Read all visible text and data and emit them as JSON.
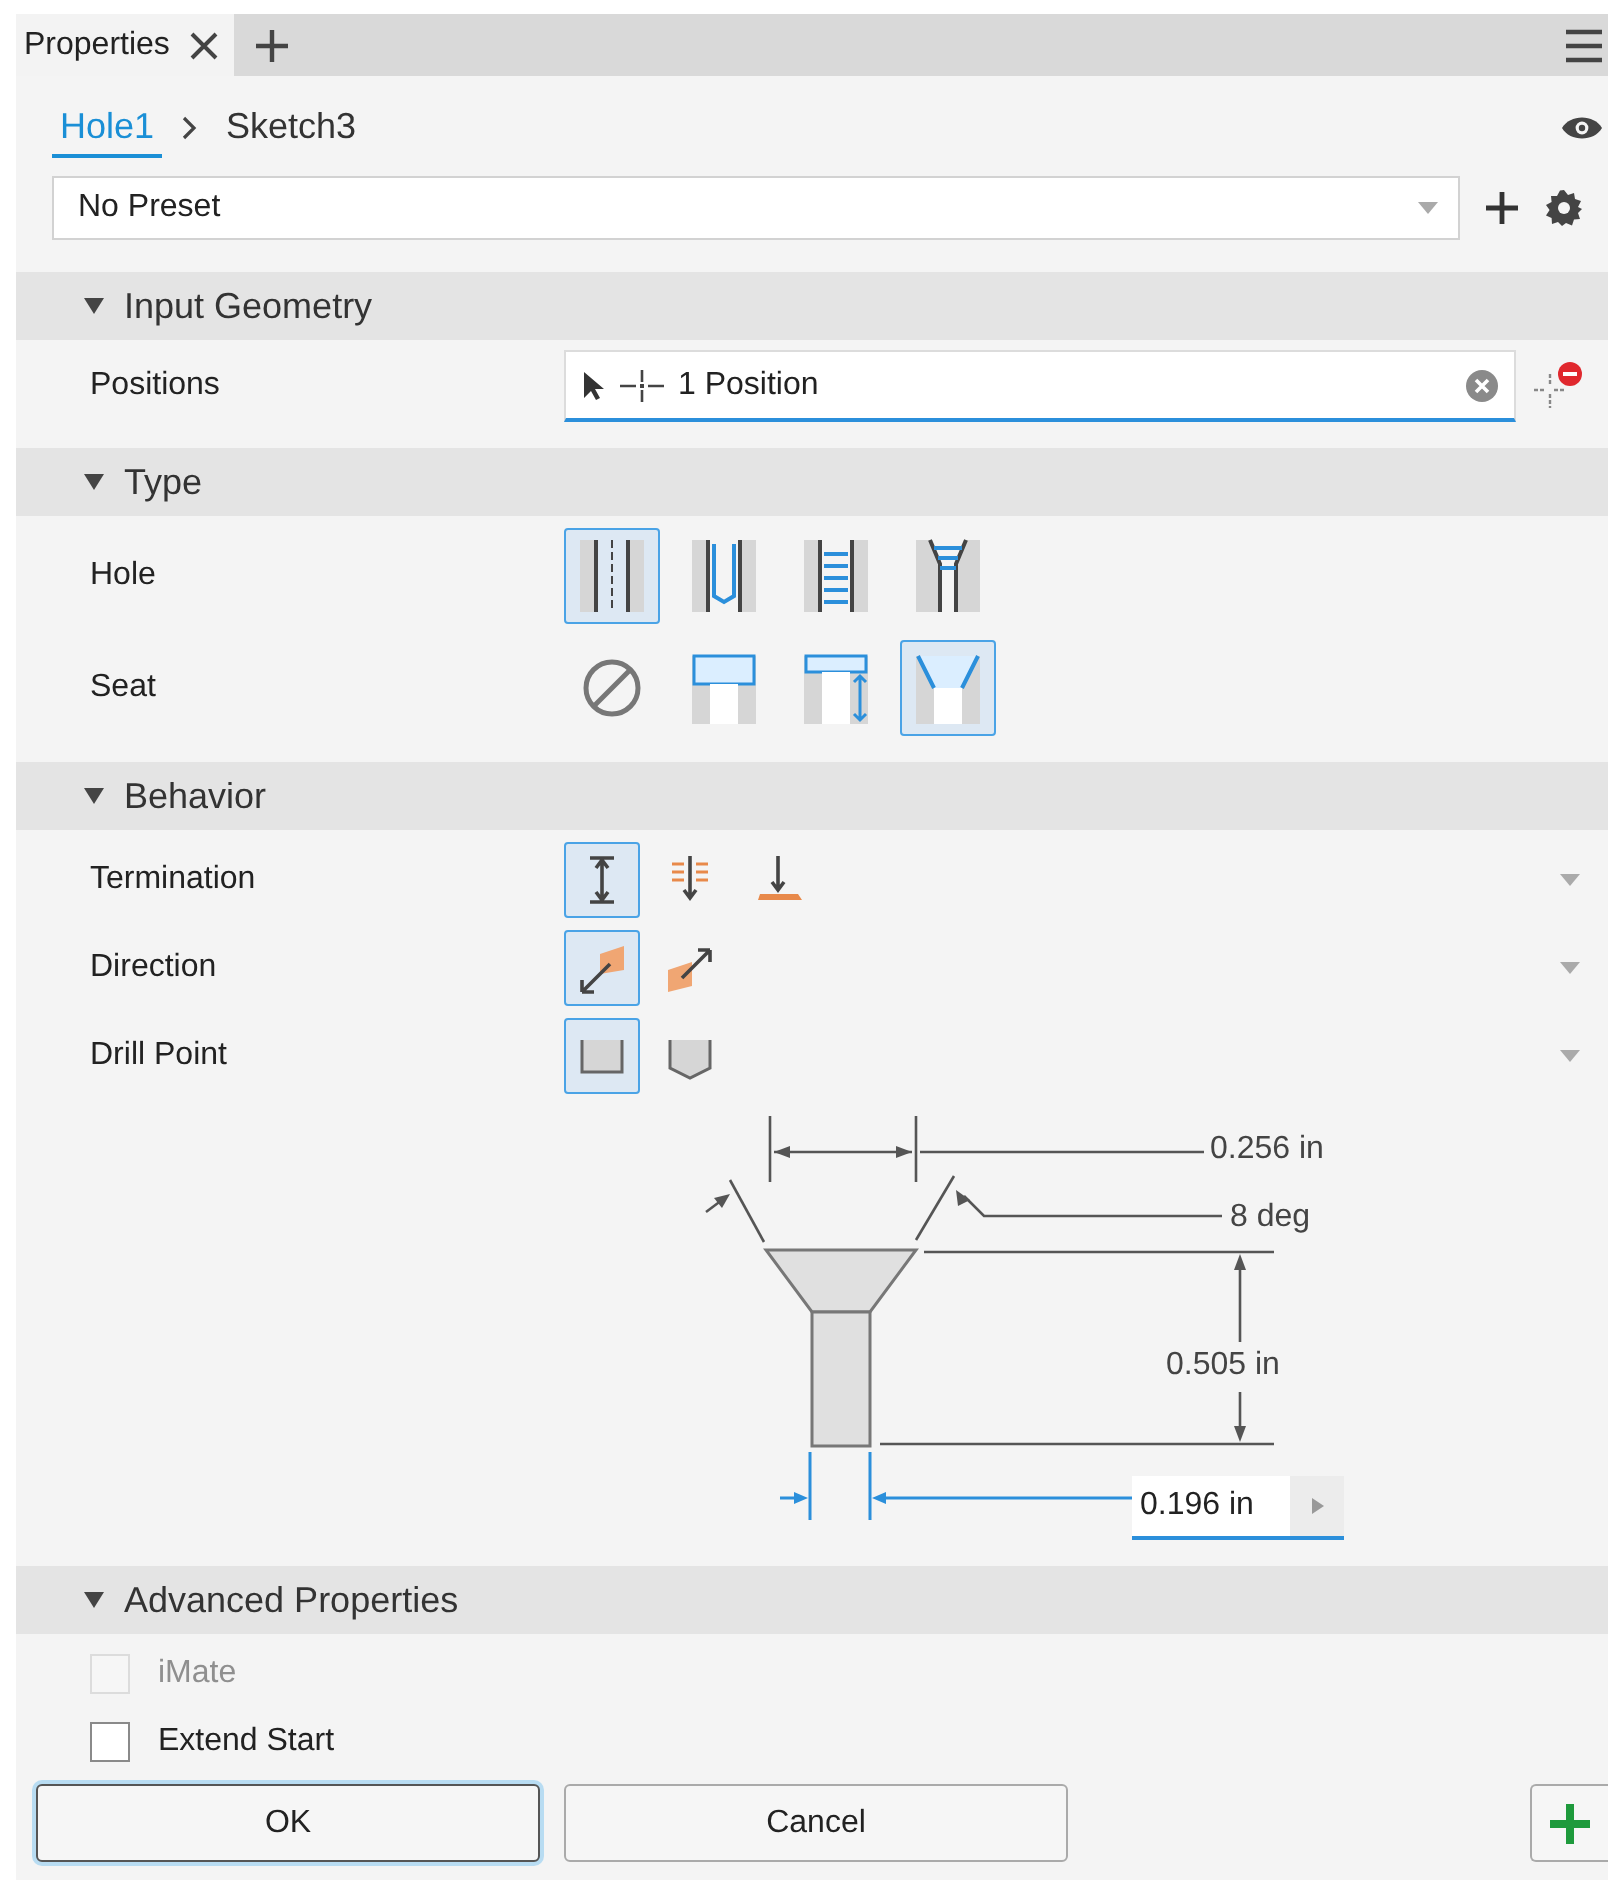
{
  "tab_bar": {
    "tabs": [
      {
        "label": "Properties",
        "selected": true
      }
    ]
  },
  "breadcrumb": [
    {
      "label": "Hole1",
      "selected": true
    },
    {
      "label": "Sketch3",
      "selected": false
    }
  ],
  "preset": {
    "value": "No Preset"
  },
  "sections": [
    {
      "title": "Input Geometry",
      "expanded": true,
      "rows": [
        {
          "kind": "selection",
          "label": "Positions",
          "value": "1 Position"
        }
      ]
    },
    {
      "title": "Type",
      "expanded": true,
      "rows": [
        {
          "kind": "choice",
          "label": "Hole",
          "options": [
            {
              "kind": "drilled",
              "selected": true
            },
            {
              "kind": "clearance",
              "selected": false
            },
            {
              "kind": "tapped",
              "selected": false
            },
            {
              "kind": "taper-tapped",
              "selected": false
            }
          ]
        },
        {
          "kind": "choice",
          "label": "Seat",
          "options": [
            {
              "kind": "none",
              "selected": false
            },
            {
              "kind": "counterbore",
              "selected": false
            },
            {
              "kind": "spotface",
              "selected": false
            },
            {
              "kind": "countersink",
              "selected": true
            }
          ]
        }
      ]
    },
    {
      "title": "Behavior",
      "expanded": true,
      "rows": [
        {
          "kind": "choice-menu",
          "label": "Termination",
          "options": [
            {
              "kind": "distance",
              "selected": true
            },
            {
              "kind": "through-all",
              "selected": false
            },
            {
              "kind": "to",
              "selected": false
            }
          ]
        },
        {
          "kind": "choice-menu",
          "label": "Direction",
          "options": [
            {
              "kind": "default",
              "selected": true
            },
            {
              "kind": "flipped",
              "selected": false
            }
          ]
        },
        {
          "kind": "choice-menu",
          "label": "Drill Point",
          "options": [
            {
              "kind": "flat",
              "selected": true
            },
            {
              "kind": "angled",
              "selected": false
            }
          ]
        },
        {
          "kind": "diagram",
          "diameter": "0.256 in",
          "angle": "8 deg",
          "depth": "0.505 in",
          "hole_diameter": {
            "value": "0.196 in"
          }
        }
      ]
    },
    {
      "title": "Advanced Properties",
      "expanded": true,
      "rows": [
        {
          "kind": "checkbox",
          "label": "iMate",
          "checked": false,
          "disabled": true
        },
        {
          "kind": "checkbox",
          "label": "Extend Start",
          "checked": false,
          "disabled": false
        }
      ]
    }
  ],
  "buttons": [
    {
      "label": "OK",
      "default": true
    },
    {
      "label": "Cancel",
      "default": false
    }
  ]
}
